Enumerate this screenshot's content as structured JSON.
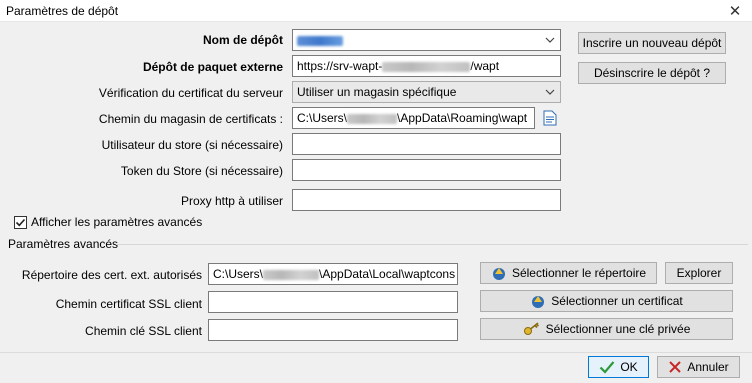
{
  "window": {
    "title": "Paramètres de dépôt"
  },
  "form": {
    "repo_name": {
      "label": "Nom de dépôt"
    },
    "external_repo": {
      "label": "Dépôt de paquet externe",
      "value_prefix": "https://srv-wapt-",
      "value_suffix": "/wapt"
    },
    "cert_verify": {
      "label": "Vérification du certificat du serveur",
      "value": "Utiliser un magasin spécifique"
    },
    "cert_store_path": {
      "label": "Chemin du magasin de certificats :",
      "value_prefix": "C:\\Users\\",
      "value_suffix": "\\AppData\\Roaming\\wapt"
    },
    "store_user": {
      "label": "Utilisateur du store (si nécessaire)",
      "value": ""
    },
    "store_token": {
      "label": "Token du Store (si nécessaire)",
      "value": ""
    },
    "http_proxy": {
      "label": "Proxy http à utiliser",
      "value": ""
    },
    "show_advanced": {
      "label": "Afficher les paramètres avancés",
      "checked": true
    }
  },
  "side_buttons": {
    "register": "Inscrire un nouveau dépôt",
    "unregister": "Désinscrire le dépôt ?"
  },
  "advanced": {
    "title": "Paramètres avancés",
    "ext_cert_dir": {
      "label": "Répertoire des cert. ext. autorisés",
      "value_prefix": "C:\\Users\\",
      "value_suffix": "\\AppData\\Local\\waptcons"
    },
    "ssl_cert_path": {
      "label": "Chemin certificat SSL client",
      "value": ""
    },
    "ssl_key_path": {
      "label": "Chemin clé SSL client",
      "value": ""
    },
    "select_dir_button": "Sélectionner le répertoire",
    "explore_button": "Explorer",
    "select_cert_button": "Sélectionner un certificat",
    "select_key_button": "Sélectionner une clé privée"
  },
  "footer": {
    "ok": "OK",
    "cancel": "Annuler"
  },
  "colors": {
    "accent": "#0078d7",
    "ok_check": "#2e9a3a",
    "cancel_x": "#c62828"
  }
}
